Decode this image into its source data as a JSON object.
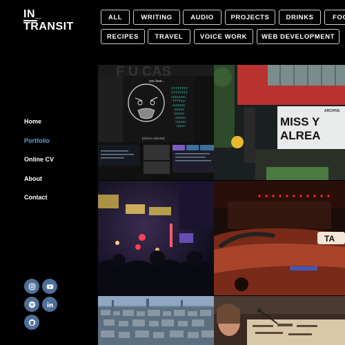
{
  "logo": {
    "line1": "IN_",
    "line2": "TRANSIT"
  },
  "nav": {
    "items": [
      {
        "label": "Home",
        "active": false
      },
      {
        "label": "Portfolio",
        "active": true
      },
      {
        "label": "Online CV",
        "active": false
      },
      {
        "label": "About",
        "active": false
      },
      {
        "label": "Contact",
        "active": false
      }
    ]
  },
  "social": [
    "instagram-icon",
    "youtube-icon",
    "spotify-icon",
    "linkedin-icon",
    "github-icon"
  ],
  "filters": {
    "row1": [
      "ALL",
      "WRITING",
      "AUDIO",
      "PROJECTS",
      "DRINKS",
      "FOOD"
    ],
    "row2": [
      "RECIPES",
      "TRAVEL",
      "VOICE WORK",
      "WEB DEVELOPMENT"
    ]
  },
  "tiles": {
    "meme": {
      "top_text": "F U CAS",
      "caption": "you lose...",
      "action": "[click to dismiss]"
    },
    "sign": {
      "line1": "MISS Y",
      "line2": "ALREA",
      "small": "ARCHIVE"
    },
    "taxi": {
      "roof": "TA"
    }
  },
  "colors": {
    "accent": "#5e9fd8",
    "social_bg": "#4e6f98"
  }
}
